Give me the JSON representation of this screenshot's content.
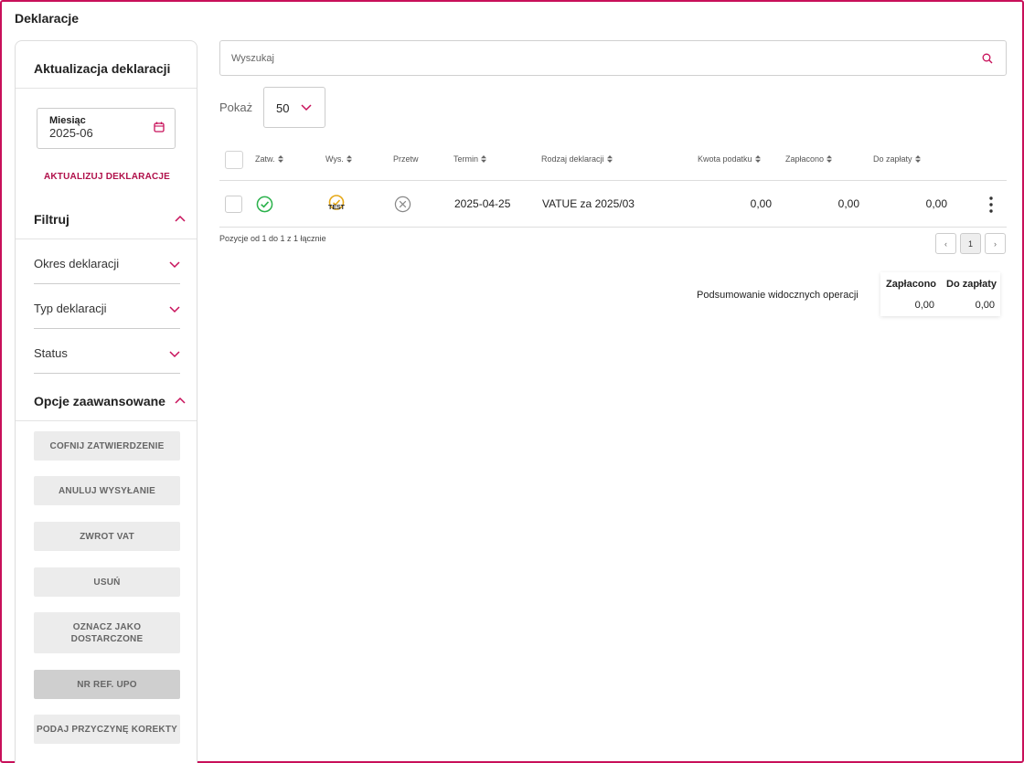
{
  "page_title": "Deklaracje",
  "sidebar": {
    "update_title": "Aktualizacja deklaracji",
    "month_label": "Miesiąc",
    "month_value": "2025-06",
    "update_button": "AKTUALIZUJ DEKLARACJE",
    "filter_title": "Filtruj",
    "filters": [
      "Okres deklaracji",
      "Typ deklaracji",
      "Status"
    ],
    "advanced_title": "Opcje zaawansowane",
    "advanced_buttons": [
      "COFNIJ ZATWIERDZENIE",
      "ANULUJ WYSYŁANIE",
      "ZWROT VAT",
      "USUŃ",
      "OZNACZ JAKO DOSTARCZONE",
      "NR REF. UPO",
      "PODAJ PRZYCZYNĘ KOREKTY"
    ]
  },
  "search": {
    "placeholder": "Wyszukaj"
  },
  "pokaz": {
    "label": "Pokaż",
    "value": "50"
  },
  "table": {
    "headers": [
      "Zatw.",
      "Wys.",
      "Przetw",
      "Termin",
      "Rodzaj deklaracji",
      "Kwota podatku",
      "Zapłacono",
      "Do zapłaty"
    ],
    "rows": [
      {
        "approved_icon": "check-circle-icon",
        "sent_badge": "TEST",
        "processed_icon": "x-circle-icon",
        "termin": "2025-04-25",
        "rodzaj": "VATUE za 2025/03",
        "kwota": "0,00",
        "zaplacono": "0,00",
        "do_zaplaty": "0,00"
      }
    ]
  },
  "pagination": {
    "info": "Pozycje od 1 do 1 z 1 łącznie",
    "page": "1",
    "prev": "‹",
    "next": "›"
  },
  "summary": {
    "label": "Podsumowanie widocznych operacji",
    "headers": [
      "Zapłacono",
      "Do zapłaty"
    ],
    "values": [
      "0,00",
      "0,00"
    ]
  },
  "colors": {
    "accent": "#c8105a",
    "success": "#2bb24c",
    "warning": "#e6a817",
    "muted": "#888888"
  }
}
